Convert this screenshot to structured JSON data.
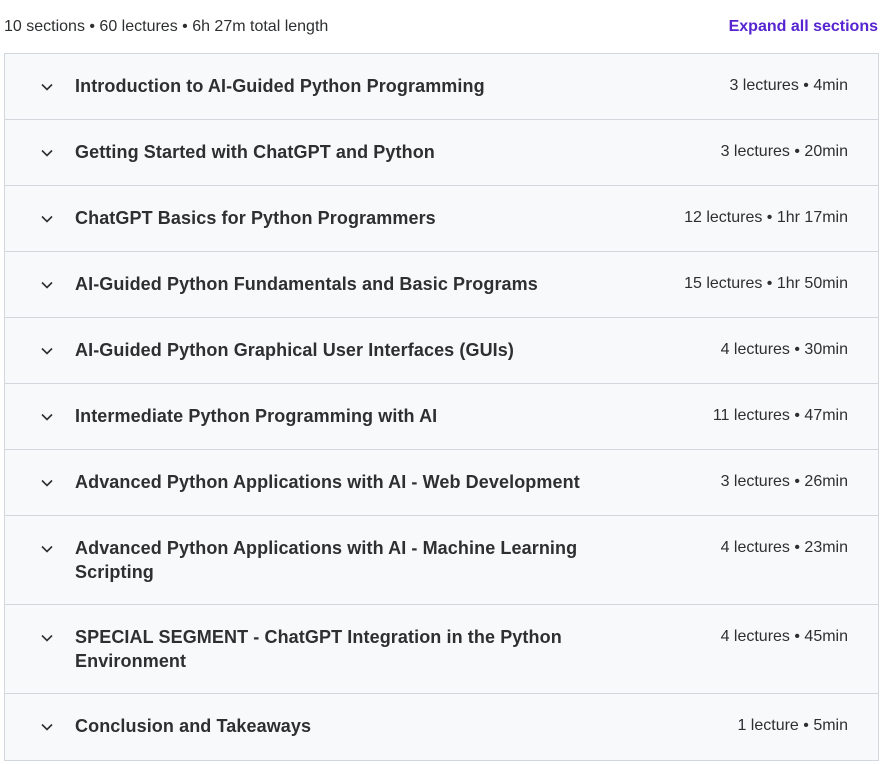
{
  "header": {
    "summary": "10 sections • 60 lectures • 6h 27m total length",
    "expand_label": "Expand all sections"
  },
  "colors": {
    "accent": "#5624d0",
    "text": "#2d2f31",
    "panel_bg": "#f7f9fa",
    "border": "#d1d7dc"
  },
  "sections": [
    {
      "title": "Introduction to AI-Guided Python Programming",
      "meta": "3 lectures • 4min",
      "icon": "chevron-down-icon"
    },
    {
      "title": "Getting Started with ChatGPT and Python",
      "meta": "3 lectures • 20min",
      "icon": "chevron-down-icon"
    },
    {
      "title": "ChatGPT Basics for Python Programmers",
      "meta": "12 lectures • 1hr 17min",
      "icon": "chevron-down-icon"
    },
    {
      "title": "AI-Guided Python Fundamentals and Basic Programs",
      "meta": "15 lectures • 1hr 50min",
      "icon": "chevron-down-icon"
    },
    {
      "title": "AI-Guided Python Graphical User Interfaces (GUIs)",
      "meta": "4 lectures • 30min",
      "icon": "chevron-down-icon"
    },
    {
      "title": "Intermediate Python Programming with AI",
      "meta": "11 lectures • 47min",
      "icon": "chevron-down-icon"
    },
    {
      "title": "Advanced Python Applications with AI - Web Development",
      "meta": "3 lectures • 26min",
      "icon": "chevron-down-icon"
    },
    {
      "title": "Advanced Python Applications with AI - Machine Learning Scripting",
      "meta": "4 lectures • 23min",
      "icon": "chevron-down-icon"
    },
    {
      "title": "SPECIAL SEGMENT - ChatGPT Integration in the Python Environment",
      "meta": "4 lectures • 45min",
      "icon": "chevron-down-icon"
    },
    {
      "title": "Conclusion and Takeaways",
      "meta": "1 lecture • 5min",
      "icon": "chevron-down-icon"
    }
  ]
}
